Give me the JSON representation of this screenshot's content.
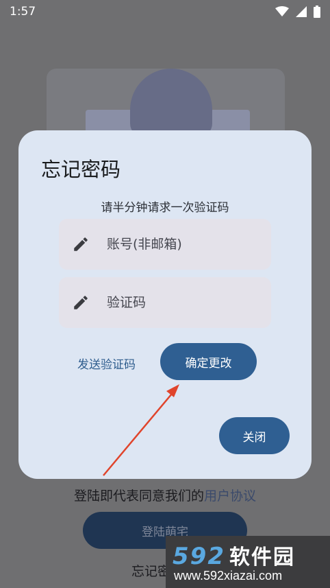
{
  "status_bar": {
    "time": "1:57"
  },
  "dialog": {
    "title": "忘记密码",
    "hint": "请半分钟请求一次验证码",
    "account_placeholder": "账号(非邮箱)",
    "code_placeholder": "验证码",
    "send_code_label": "发送验证码",
    "confirm_label": "确定更改",
    "close_label": "关闭"
  },
  "background": {
    "agreement_prefix": "登陆即代表同意我们的",
    "agreement_link": "用户协议",
    "login_label": "登陆萌宅",
    "forgot_label": "忘记密"
  },
  "watermark": {
    "brand_number": "592",
    "brand_text": "软件园",
    "url": "www.592xiazai.com"
  },
  "colors": {
    "accent": "#2f5f92",
    "dialog_bg": "#dde6f3",
    "field_bg": "#e4e2ea",
    "arrow": "#e0442b"
  }
}
